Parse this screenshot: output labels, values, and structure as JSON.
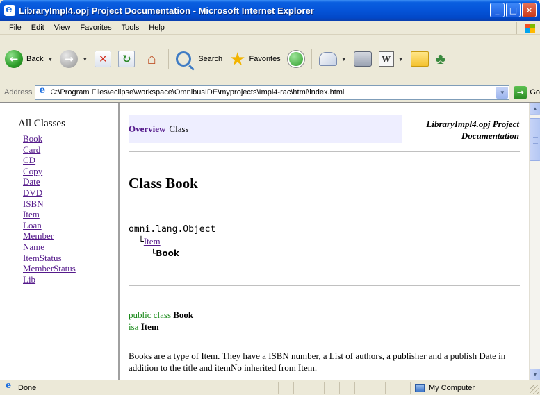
{
  "window": {
    "title": "LibraryImpl4.opj Project Documentation - Microsoft Internet Explorer",
    "controls": {
      "minimize": "_",
      "maximize": "□",
      "close": "✕"
    }
  },
  "menu": [
    {
      "label": "File"
    },
    {
      "label": "Edit"
    },
    {
      "label": "View"
    },
    {
      "label": "Favorites"
    },
    {
      "label": "Tools"
    },
    {
      "label": "Help"
    }
  ],
  "toolbar": {
    "back_label": "Back",
    "search_label": "Search",
    "favorites_label": "Favorites",
    "icons": {
      "back": "←",
      "forward": "→",
      "stop": "✕",
      "refresh": "↻",
      "home": "⌂",
      "favorites": "★",
      "word": "W",
      "messenger": "♣"
    },
    "dropdown": "▼"
  },
  "address": {
    "label": "Address",
    "url": "C:\\Program Files\\eclipse\\workspace\\OmnibusIDE\\myprojects\\Impl4-rac\\html\\index.html",
    "go_label": "Go",
    "go_icon": "→",
    "dropdown": "▼"
  },
  "sidebar": {
    "heading": "All Classes",
    "classes": [
      "Book",
      "Card",
      "CD",
      "Copy",
      "Date",
      "DVD",
      "ISBN",
      "Item",
      "Loan",
      "Member",
      "Name",
      "ItemStatus",
      "MemberStatus",
      "Lib"
    ]
  },
  "doc": {
    "nav_overview": "Overview",
    "nav_class": "Class",
    "project_title_line1": "LibraryImpl4.opj Project",
    "project_title_line2": "Documentation",
    "class_title": "Class Book",
    "hierarchy": {
      "root": "omni.lang.Object",
      "parent": "Item",
      "self": "Book",
      "branch": "└"
    },
    "declaration": {
      "keyword_public_class": "public class",
      "class_name": "Book",
      "keyword_isa": "isa",
      "super_name": "Item"
    },
    "description": "Books are a type of Item. They have a ISBN number, a List of authors, a publisher and a publish Date in addition to the title and itemNo inherited from Item."
  },
  "scrollbar": {
    "up": "▲",
    "down": "▼"
  },
  "status": {
    "text": "Done",
    "zone": "My Computer"
  }
}
